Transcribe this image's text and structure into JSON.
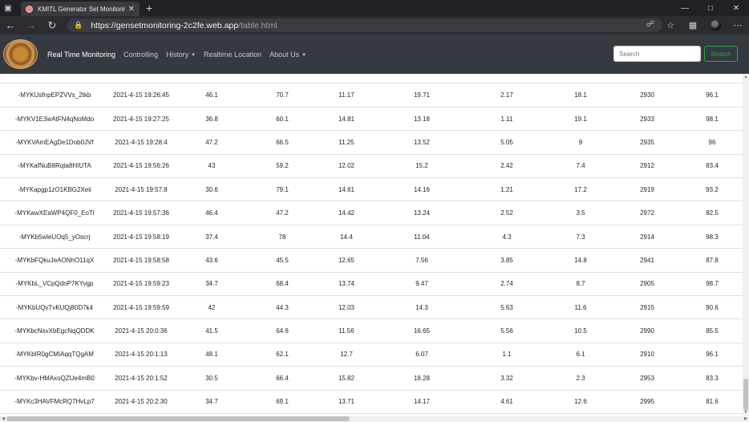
{
  "browser": {
    "tab_title": "KMITL Generator Set Monitoring",
    "url_host": "https://gensetmonitoring-2c2fe.web.app",
    "url_path": "/table.html"
  },
  "navbar": {
    "links": [
      {
        "label": "Real Time Monitoring"
      },
      {
        "label": "Controlling"
      },
      {
        "label": "History"
      },
      {
        "label": "Realtime Location"
      },
      {
        "label": "About Us"
      }
    ],
    "search_placeholder": "Search",
    "search_button": "Search"
  },
  "table": {
    "rows": [
      [
        "-MYKUsfnpEPZVVs_2tkb",
        "2021-4-15 19:26:45",
        "46.1",
        "70.7",
        "11.17",
        "19.71",
        "2.17",
        "18.1",
        "2930",
        "96.1"
      ],
      [
        "-MYKV1E3wAtFN4qNoMdo",
        "2021-4-15 19:27:25",
        "36.8",
        "60.1",
        "14.81",
        "13.18",
        "1.11",
        "19.1",
        "2933",
        "98.1"
      ],
      [
        "-MYKVAmEAgDe1Dob0JVf",
        "2021-4-15 19:28:4",
        "47.2",
        "66.5",
        "11.25",
        "13.52",
        "5.05",
        "9",
        "2935",
        "96"
      ],
      [
        "-MYKafNuB8Rqta8HIUTA",
        "2021-4-15 19:56:26",
        "43",
        "59.2",
        "12.02",
        "15.2",
        "2.42",
        "7.4",
        "2912",
        "83.4"
      ],
      [
        "-MYKapgp1zO1KBG2Xeii",
        "2021-4-15 19:57:8",
        "30.6",
        "79.1",
        "14.61",
        "14.16",
        "1.21",
        "17.2",
        "2919",
        "93.2"
      ],
      [
        "-MYKawXEaWP4QF0_EoTl",
        "2021-4-15 19:57:36",
        "46.4",
        "47.2",
        "14.42",
        "13.24",
        "2.52",
        "3.5",
        "2972",
        "82.5"
      ],
      [
        "-MYKb5wleUOq5_yOscrj",
        "2021-4-15 19:58:19",
        "37.4",
        "78",
        "14.4",
        "11.04",
        "4.3",
        "7.3",
        "2914",
        "98.3"
      ],
      [
        "-MYKbFQkuJeAONhO11qX",
        "2021-4-15 19:58:58",
        "43.6",
        "45.5",
        "12.65",
        "7.56",
        "3.85",
        "14.8",
        "2941",
        "87.8"
      ],
      [
        "-MYKbL_VCpQdnP7KYvgp",
        "2021-4-15 19:59:23",
        "34.7",
        "68.4",
        "13.74",
        "9.47",
        "2.74",
        "8.7",
        "2905",
        "98.7"
      ],
      [
        "-MYKbUQvTvKUQj80D7k4",
        "2021-4-15 19:59:59",
        "42",
        "44.3",
        "12.03",
        "14.3",
        "5.63",
        "11.6",
        "2915",
        "90.6"
      ],
      [
        "-MYKbcNsvXbEgcNqQDDK",
        "2021-4-15 20:0:36",
        "41.5",
        "64.6",
        "11.56",
        "16.65",
        "5.56",
        "10.5",
        "2990",
        "85.5"
      ],
      [
        "-MYKbIR0gCMIAqqTQgAM",
        "2021-4-15 20:1:13",
        "48.1",
        "62.1",
        "12.7",
        "6.07",
        "1.1",
        "6.1",
        "2910",
        "96.1"
      ],
      [
        "-MYKbv-HMAxoQZUe4mB0",
        "2021-4-15 20:1:52",
        "30.5",
        "66.4",
        "15.82",
        "18.28",
        "3.32",
        "2.3",
        "2953",
        "83.3"
      ],
      [
        "-MYKc3HAVFMcRQ7HvLp7",
        "2021-4-15 20:2:30",
        "34.7",
        "69.1",
        "13.71",
        "14.17",
        "4.61",
        "12.6",
        "2995",
        "81.6"
      ]
    ]
  }
}
